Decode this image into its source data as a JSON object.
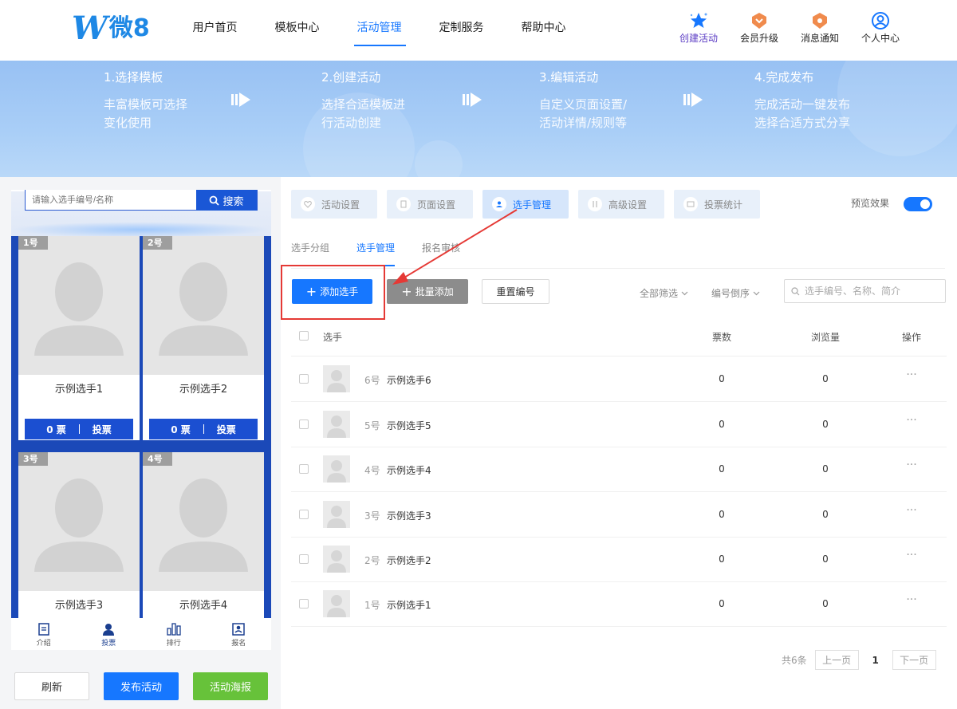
{
  "logo": {
    "letter": "W",
    "text": "微8"
  },
  "nav": [
    {
      "label": "用户首页"
    },
    {
      "label": "模板中心"
    },
    {
      "label": "活动管理",
      "active": true
    },
    {
      "label": "定制服务"
    },
    {
      "label": "帮助中心"
    }
  ],
  "header_actions": [
    {
      "label": "创建活动",
      "icon": "star-icon"
    },
    {
      "label": "会员升级",
      "icon": "vip-badge-icon"
    },
    {
      "label": "消息通知",
      "icon": "bell-badge-icon"
    },
    {
      "label": "个人中心",
      "icon": "user-circle-icon"
    }
  ],
  "steps": [
    {
      "title": "1.选择模板",
      "desc": "丰富模板可选择变化使用"
    },
    {
      "title": "2.创建活动",
      "desc": "选择合适模板进行活动创建"
    },
    {
      "title": "3.编辑活动",
      "desc": "自定义页面设置/活动详情/规则等"
    },
    {
      "title": "4.完成发布",
      "desc": "完成活动一键发布选择合适方式分享"
    }
  ],
  "phone": {
    "search_placeholder": "请输入选手编号/名称",
    "search_button": "搜索",
    "cards": [
      {
        "badge": "1号",
        "name": "示例选手1",
        "votes": "0 票",
        "vote_btn": "投票"
      },
      {
        "badge": "2号",
        "name": "示例选手2",
        "votes": "0 票",
        "vote_btn": "投票"
      },
      {
        "badge": "3号",
        "name": "示例选手3"
      },
      {
        "badge": "4号",
        "name": "示例选手4"
      }
    ],
    "tabs": [
      {
        "label": "介绍",
        "icon": "document-icon"
      },
      {
        "label": "投票",
        "icon": "person-icon",
        "active": true
      },
      {
        "label": "排行",
        "icon": "bar-chart-icon"
      },
      {
        "label": "报名",
        "icon": "id-card-icon"
      }
    ]
  },
  "bottom_buttons": {
    "refresh": "刷新",
    "publish": "发布活动",
    "poster": "活动海报"
  },
  "top_tabs": [
    {
      "label": "活动设置",
      "icon": "heart-icon"
    },
    {
      "label": "页面设置",
      "icon": "page-icon"
    },
    {
      "label": "选手管理",
      "icon": "contestant-icon",
      "active": true
    },
    {
      "label": "高级设置",
      "icon": "advanced-icon"
    },
    {
      "label": "投票统计",
      "icon": "stats-icon"
    }
  ],
  "preview": {
    "label": "预览效果",
    "on": true
  },
  "sub_tabs": [
    {
      "label": "选手分组"
    },
    {
      "label": "选手管理",
      "active": true
    },
    {
      "label": "报名审核"
    }
  ],
  "toolbar": {
    "add": "添加选手",
    "batch_add": "批量添加",
    "renumber": "重置编号",
    "filter_all": "全部筛选",
    "sort": "编号倒序",
    "search_placeholder": "选手编号、名称、简介"
  },
  "table": {
    "headers": {
      "player": "选手",
      "votes": "票数",
      "views": "浏览量",
      "ops": "操作"
    },
    "rows": [
      {
        "num": "6号",
        "name": "示例选手6",
        "votes": "0",
        "views": "0"
      },
      {
        "num": "5号",
        "name": "示例选手5",
        "votes": "0",
        "views": "0"
      },
      {
        "num": "4号",
        "name": "示例选手4",
        "votes": "0",
        "views": "0"
      },
      {
        "num": "3号",
        "name": "示例选手3",
        "votes": "0",
        "views": "0"
      },
      {
        "num": "2号",
        "name": "示例选手2",
        "votes": "0",
        "views": "0"
      },
      {
        "num": "1号",
        "name": "示例选手1",
        "votes": "0",
        "views": "0"
      }
    ],
    "ops_symbol": "···"
  },
  "pagination": {
    "total": "共6条",
    "prev": "上一页",
    "current": "1",
    "next": "下一页"
  },
  "colors": {
    "primary": "#1677ff",
    "green": "#67c23a",
    "highlight": "#e53935",
    "phone_bg": "#1b49b8"
  }
}
